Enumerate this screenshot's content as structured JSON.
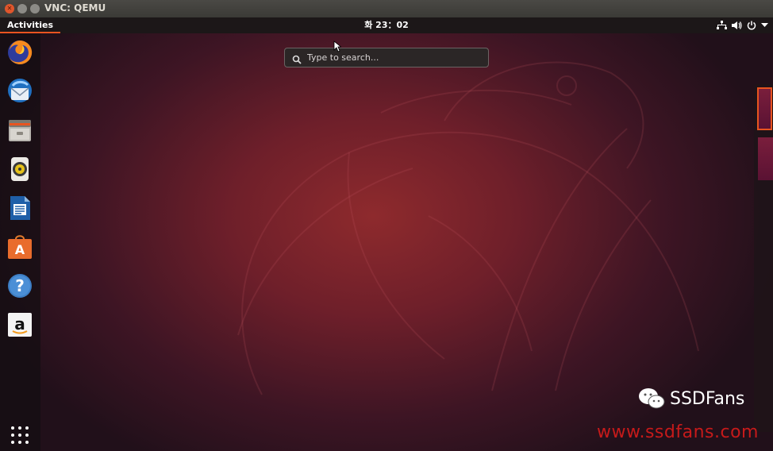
{
  "window": {
    "title": "VNC: QEMU",
    "controls": [
      "close-icon",
      "minimize-icon",
      "maximize-icon"
    ]
  },
  "topbar": {
    "activities_label": "Activities",
    "clock": "화 23：02",
    "status_icons": [
      "network-icon",
      "volume-icon",
      "power-icon",
      "chevron-down-icon"
    ]
  },
  "dock": {
    "items": [
      {
        "name": "firefox",
        "icon": "firefox-icon"
      },
      {
        "name": "thunderbird",
        "icon": "thunderbird-icon"
      },
      {
        "name": "files",
        "icon": "files-icon"
      },
      {
        "name": "rhythmbox",
        "icon": "rhythmbox-icon"
      },
      {
        "name": "libreoffice-writer",
        "icon": "writer-icon"
      },
      {
        "name": "ubuntu-software",
        "icon": "software-icon"
      },
      {
        "name": "help",
        "icon": "help-icon"
      },
      {
        "name": "amazon",
        "icon": "amazon-icon"
      },
      {
        "name": "show-applications",
        "icon": "app-grid-icon"
      }
    ]
  },
  "search": {
    "placeholder": "Type to search..."
  },
  "workspaces": {
    "count": 2,
    "active_index": 0
  },
  "watermark": {
    "name": "SSDFans",
    "url": "www.ssdfans.com"
  },
  "colors": {
    "accent": "#e95420",
    "topbar": "#1c1718",
    "watermark_url": "#c61a1a"
  }
}
